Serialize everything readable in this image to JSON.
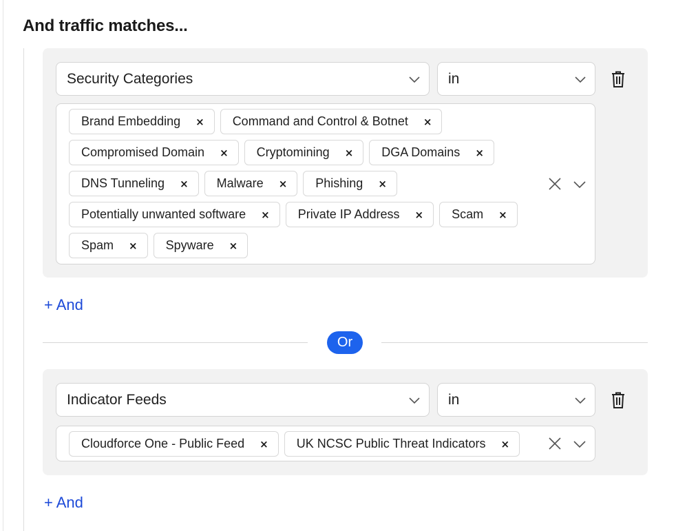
{
  "heading": "And traffic matches...",
  "rule1": {
    "field": "Security Categories",
    "operator": "in",
    "values": [
      "Brand Embedding",
      "Command and Control & Botnet",
      "Compromised Domain",
      "Cryptomining",
      "DGA Domains",
      "DNS Tunneling",
      "Malware",
      "Phishing",
      "Potentially unwanted software",
      "Private IP Address",
      "Scam",
      "Spam",
      "Spyware"
    ]
  },
  "add_and_label": "+ And",
  "or_label": "Or",
  "rule2": {
    "field": "Indicator Feeds",
    "operator": "in",
    "values": [
      "Cloudforce One - Public Feed",
      "UK NCSC Public Threat Indicators"
    ]
  },
  "remove_glyph": "×",
  "icons": [
    "chevron-down-icon",
    "trash-icon",
    "close-icon"
  ]
}
